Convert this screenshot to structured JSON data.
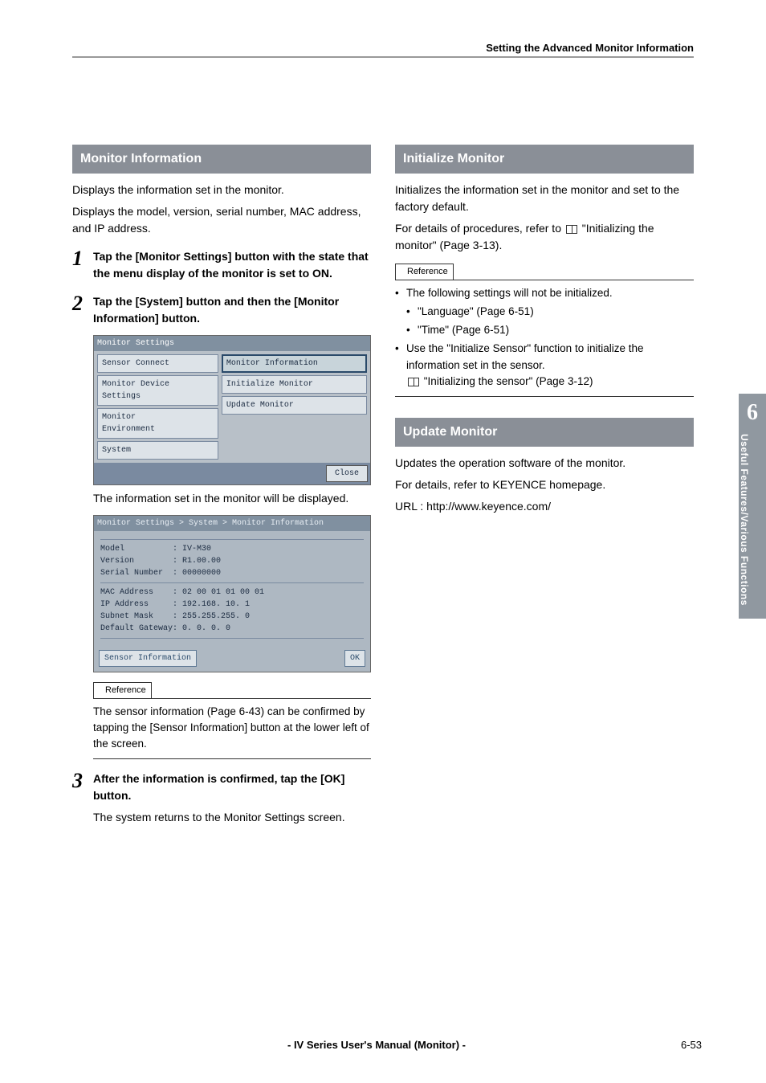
{
  "header": {
    "running_title": "Setting the Advanced Monitor Information"
  },
  "left": {
    "section_title": "Monitor Information",
    "intro_l1": "Displays the information set in the monitor.",
    "intro_l2": "Displays the model, version, serial number, MAC address, and IP address.",
    "step1": {
      "n": "1",
      "text": "Tap the [Monitor Settings] button with the state that the menu display of the monitor is set to ON."
    },
    "step2": {
      "n": "2",
      "text": "Tap the [System] button and then the [Monitor Information] button.",
      "after": "The information set in the monitor will be displayed."
    },
    "ss1": {
      "title": "Monitor Settings",
      "left_buttons": [
        "Sensor Connect",
        "Monitor Device\nSettings",
        "Monitor\nEnvironment",
        "System"
      ],
      "right_buttons": [
        "Monitor Information",
        "Initialize Monitor",
        "Update Monitor"
      ],
      "close": "Close"
    },
    "ss2": {
      "breadcrumb": "Monitor Settings > System > Monitor Information",
      "rows1": [
        {
          "label": "Model",
          "value": "IV-M30"
        },
        {
          "label": "Version",
          "value": "R1.00.00"
        },
        {
          "label": "Serial Number",
          "value": "00000000"
        }
      ],
      "rows2": [
        {
          "label": "MAC Address",
          "value": "02 00 01 01 00 01"
        },
        {
          "label": "IP Address",
          "value": "192.168. 10.  1"
        },
        {
          "label": "Subnet Mask",
          "value": "255.255.255.  0"
        },
        {
          "label": "Default Gateway",
          "value": "  0.  0.  0.  0"
        }
      ],
      "sensor_info_btn": "Sensor Information",
      "ok_btn": "OK"
    },
    "reference": {
      "label": "Reference",
      "text": "The sensor information (Page 6-43) can be confirmed by tapping the [Sensor Information] button at the lower left of the screen."
    },
    "step3": {
      "n": "3",
      "text": "After the information is confirmed, tap the [OK] button.",
      "after": "The system returns to the Monitor Settings screen."
    }
  },
  "right": {
    "init": {
      "title": "Initialize Monitor",
      "p1": "Initializes the information set in the monitor and set to the factory default.",
      "p2a": "For details of procedures, refer to ",
      "p2b": " \"Initializing the monitor\" (Page 3-13).",
      "ref_label": "Reference",
      "b1": "The following settings will not be initialized.",
      "b1a": "\"Language\" (Page 6-51)",
      "b1b": "\"Time\" (Page 6-51)",
      "b2": "Use the \"Initialize Sensor\" function to initialize the information set in the sensor.",
      "b2ref": " \"Initializing the sensor\" (Page 3-12)"
    },
    "update": {
      "title": "Update Monitor",
      "p1": "Updates the operation software of the monitor.",
      "p2": "For details, refer to KEYENCE homepage.",
      "p3": "URL : http://www.keyence.com/"
    }
  },
  "sidetab": {
    "num": "6",
    "text": "Useful Features/Various Functions"
  },
  "footer": {
    "center": "- IV Series User's Manual (Monitor) -",
    "page": "6-53"
  }
}
